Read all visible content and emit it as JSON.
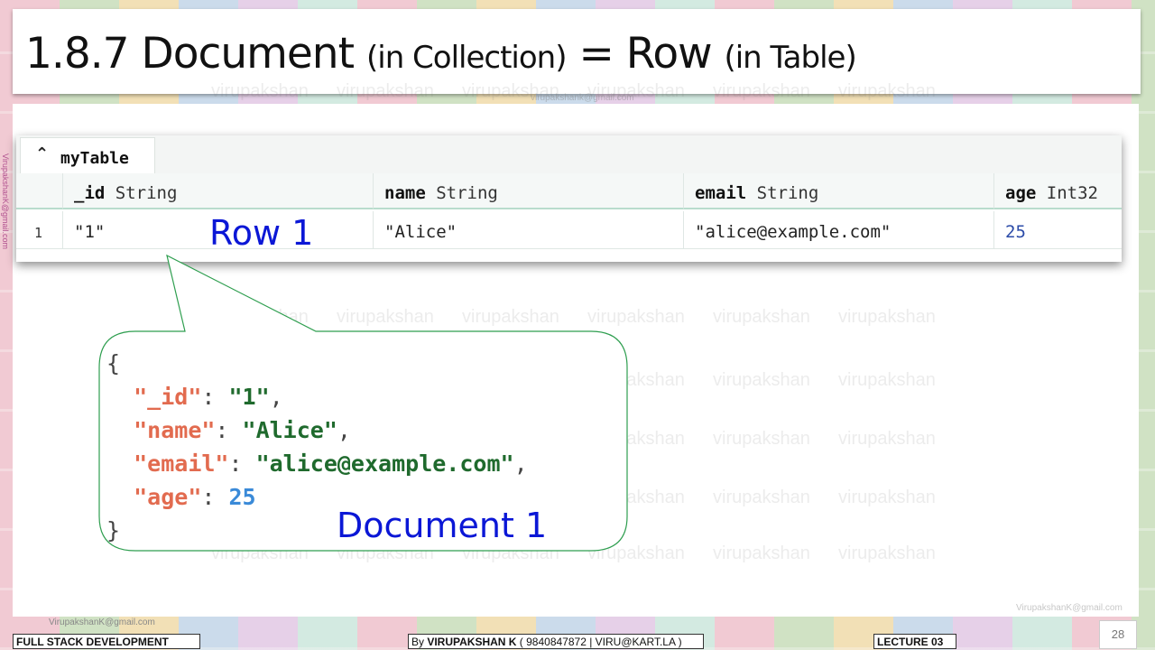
{
  "slide": {
    "title_main_1": "1.8.7 Document",
    "title_paren_1": "(in Collection)",
    "title_eq": "= Row",
    "title_paren_2": "(in Table)"
  },
  "watermark": {
    "text": "virupakshan",
    "email": "VirupakshanK@gmail.com",
    "email_small": "virupakshank@gmail.com"
  },
  "table": {
    "tab_name": "myTable",
    "tab_icon": "up-chevron-icon",
    "columns": [
      {
        "name": "_id",
        "type": "String"
      },
      {
        "name": "name",
        "type": "String"
      },
      {
        "name": "email",
        "type": "String"
      },
      {
        "name": "age",
        "type": "Int32"
      }
    ],
    "rows": [
      {
        "num": "1",
        "id": "\"1\"",
        "name": "\"Alice\"",
        "email": "\"alice@example.com\"",
        "age": "25"
      }
    ]
  },
  "callouts": {
    "row": "Row 1",
    "document": "Document 1"
  },
  "json_doc": {
    "open": "{",
    "k_id": "\"_id\"",
    "v_id": "\"1\"",
    "k_name": "\"name\"",
    "v_name": "\"Alice\"",
    "k_email": "\"email\"",
    "v_email": "\"alice@example.com\"",
    "k_age": "\"age\"",
    "v_age": "25",
    "close": "}"
  },
  "footer": {
    "course": "FULL STACK DEVELOPMENT",
    "by_prefix": "By ",
    "author": "VIRUPAKSHAN K",
    "contact": " ( 9840847872 | VIRU@KART.LA )",
    "lecture": "LECTURE 03",
    "page": "28",
    "email": "VirupakshanK@gmail.com"
  },
  "colors": {
    "callout": "#0b17d6",
    "bubble_border": "#2e9e4f",
    "json_key": "#e26b4f",
    "json_string": "#1f6a2d",
    "json_number": "#3a8ad8"
  }
}
